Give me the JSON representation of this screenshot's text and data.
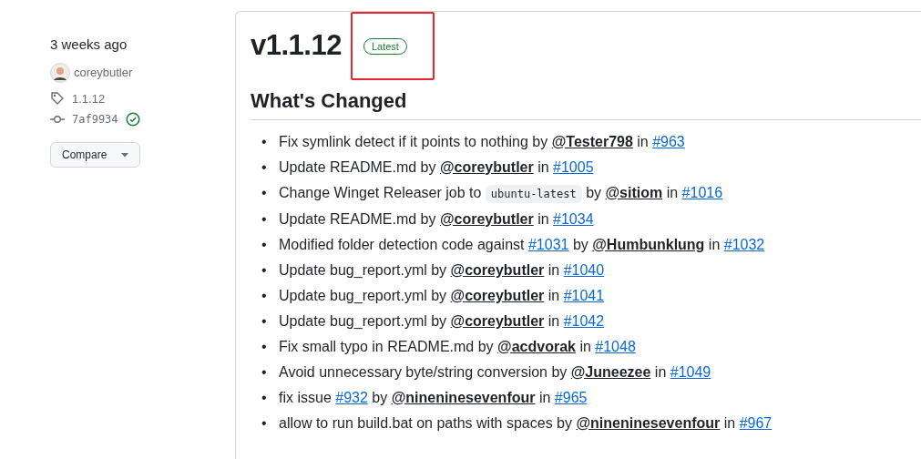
{
  "sidebar": {
    "date": "3 weeks ago",
    "author": "coreybutler",
    "tag": "1.1.12",
    "commit": "7af9934",
    "commit_verified": true,
    "compare_button": "Compare"
  },
  "release": {
    "title": "v1.1.12",
    "badge": {
      "label": "Latest",
      "highlighted": true
    },
    "section_title": "What's Changed",
    "bullet": "•",
    "changes": [
      {
        "parts": [
          {
            "kind": "text",
            "text": "Fix symlink detect if it points to nothing by "
          },
          {
            "kind": "user",
            "text": "@Tester798"
          },
          {
            "kind": "text",
            "text": " in "
          },
          {
            "kind": "pr",
            "text": "#963"
          }
        ]
      },
      {
        "parts": [
          {
            "kind": "text",
            "text": "Update README.md by "
          },
          {
            "kind": "user",
            "text": "@coreybutler"
          },
          {
            "kind": "text",
            "text": " in "
          },
          {
            "kind": "pr",
            "text": "#1005"
          }
        ]
      },
      {
        "parts": [
          {
            "kind": "text",
            "text": "Change Winget Releaser job to "
          },
          {
            "kind": "code",
            "text": "ubuntu-latest"
          },
          {
            "kind": "text",
            "text": " by "
          },
          {
            "kind": "user",
            "text": "@sitiom"
          },
          {
            "kind": "text",
            "text": " in "
          },
          {
            "kind": "pr",
            "text": "#1016"
          }
        ]
      },
      {
        "parts": [
          {
            "kind": "text",
            "text": "Update README.md by "
          },
          {
            "kind": "user",
            "text": "@coreybutler"
          },
          {
            "kind": "text",
            "text": " in "
          },
          {
            "kind": "pr",
            "text": "#1034"
          }
        ]
      },
      {
        "parts": [
          {
            "kind": "text",
            "text": "Modified folder detection code against "
          },
          {
            "kind": "pr",
            "text": "#1031"
          },
          {
            "kind": "text",
            "text": " by "
          },
          {
            "kind": "user",
            "text": "@Humbunklung"
          },
          {
            "kind": "text",
            "text": " in "
          },
          {
            "kind": "pr",
            "text": "#1032"
          }
        ]
      },
      {
        "parts": [
          {
            "kind": "text",
            "text": "Update bug_report.yml by "
          },
          {
            "kind": "user",
            "text": "@coreybutler"
          },
          {
            "kind": "text",
            "text": " in "
          },
          {
            "kind": "pr",
            "text": "#1040"
          }
        ]
      },
      {
        "parts": [
          {
            "kind": "text",
            "text": "Update bug_report.yml by "
          },
          {
            "kind": "user",
            "text": "@coreybutler"
          },
          {
            "kind": "text",
            "text": " in "
          },
          {
            "kind": "pr",
            "text": "#1041"
          }
        ]
      },
      {
        "parts": [
          {
            "kind": "text",
            "text": "Update bug_report.yml by "
          },
          {
            "kind": "user",
            "text": "@coreybutler"
          },
          {
            "kind": "text",
            "text": " in "
          },
          {
            "kind": "pr",
            "text": "#1042"
          }
        ]
      },
      {
        "parts": [
          {
            "kind": "text",
            "text": "Fix small typo in README.md by "
          },
          {
            "kind": "user",
            "text": "@acdvorak"
          },
          {
            "kind": "text",
            "text": " in "
          },
          {
            "kind": "pr",
            "text": "#1048"
          }
        ]
      },
      {
        "parts": [
          {
            "kind": "text",
            "text": "Avoid unnecessary byte/string conversion by "
          },
          {
            "kind": "user",
            "text": "@Juneezee"
          },
          {
            "kind": "text",
            "text": " in "
          },
          {
            "kind": "pr",
            "text": "#1049"
          }
        ]
      },
      {
        "parts": [
          {
            "kind": "text",
            "text": "fix issue "
          },
          {
            "kind": "pr",
            "text": "#932"
          },
          {
            "kind": "text",
            "text": " by "
          },
          {
            "kind": "user",
            "text": "@nineninesevenfour"
          },
          {
            "kind": "text",
            "text": " in "
          },
          {
            "kind": "pr",
            "text": "#965"
          }
        ]
      },
      {
        "parts": [
          {
            "kind": "text",
            "text": "allow to run build.bat on paths with spaces by "
          },
          {
            "kind": "user",
            "text": "@nineninesevenfour"
          },
          {
            "kind": "text",
            "text": " in "
          },
          {
            "kind": "pr",
            "text": "#967"
          }
        ]
      }
    ]
  }
}
